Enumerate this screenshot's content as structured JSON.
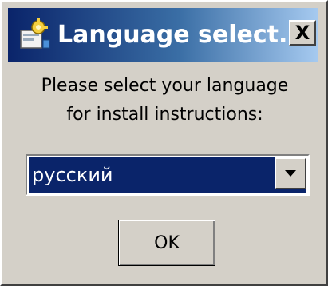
{
  "window": {
    "title": "Language select...",
    "close_label": "X"
  },
  "message": {
    "line1": "Please select your language",
    "line2": "for install instructions:"
  },
  "language_select": {
    "selected": "русский"
  },
  "buttons": {
    "ok_label": "OK"
  },
  "icons": {
    "app": "installer-icon",
    "dropdown": "chevron-down-icon"
  },
  "colors": {
    "title_bar_start": "#0a246a",
    "title_bar_end": "#a6caf0",
    "selection": "#0a246a",
    "face": "#d4d0c8"
  }
}
